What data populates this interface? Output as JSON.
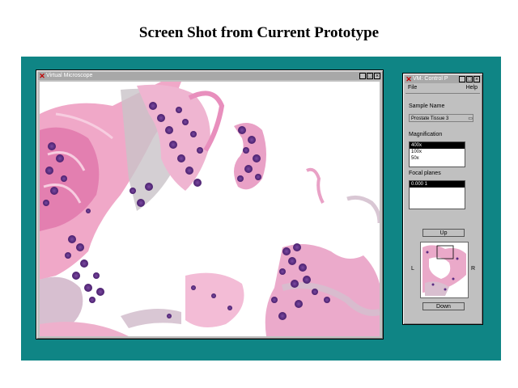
{
  "slide": {
    "title": "Screen Shot from Current Prototype"
  },
  "viewer": {
    "title": "Virtual Microscope",
    "buttons": [
      "_",
      "□",
      "×"
    ]
  },
  "control": {
    "title": "VM: Control P",
    "buttons": [
      "_",
      "□",
      "×"
    ],
    "menu": {
      "file": "File",
      "help": "Help"
    },
    "sample_label": "Sample Name",
    "sample_value": "Prostate Tissue 3",
    "magnification_label": "Magnification",
    "magnifications": [
      "400x",
      "100x",
      "50x"
    ],
    "focal_label": "Focal planes",
    "focal_planes": [
      "0.000 1"
    ],
    "nav": {
      "up": "Up",
      "down": "Down",
      "left": "L",
      "right": "R"
    }
  },
  "colors": {
    "desktop": "#0f8585",
    "tissue_pink": "#e89ac0",
    "nuclei": "#5a2a82"
  }
}
